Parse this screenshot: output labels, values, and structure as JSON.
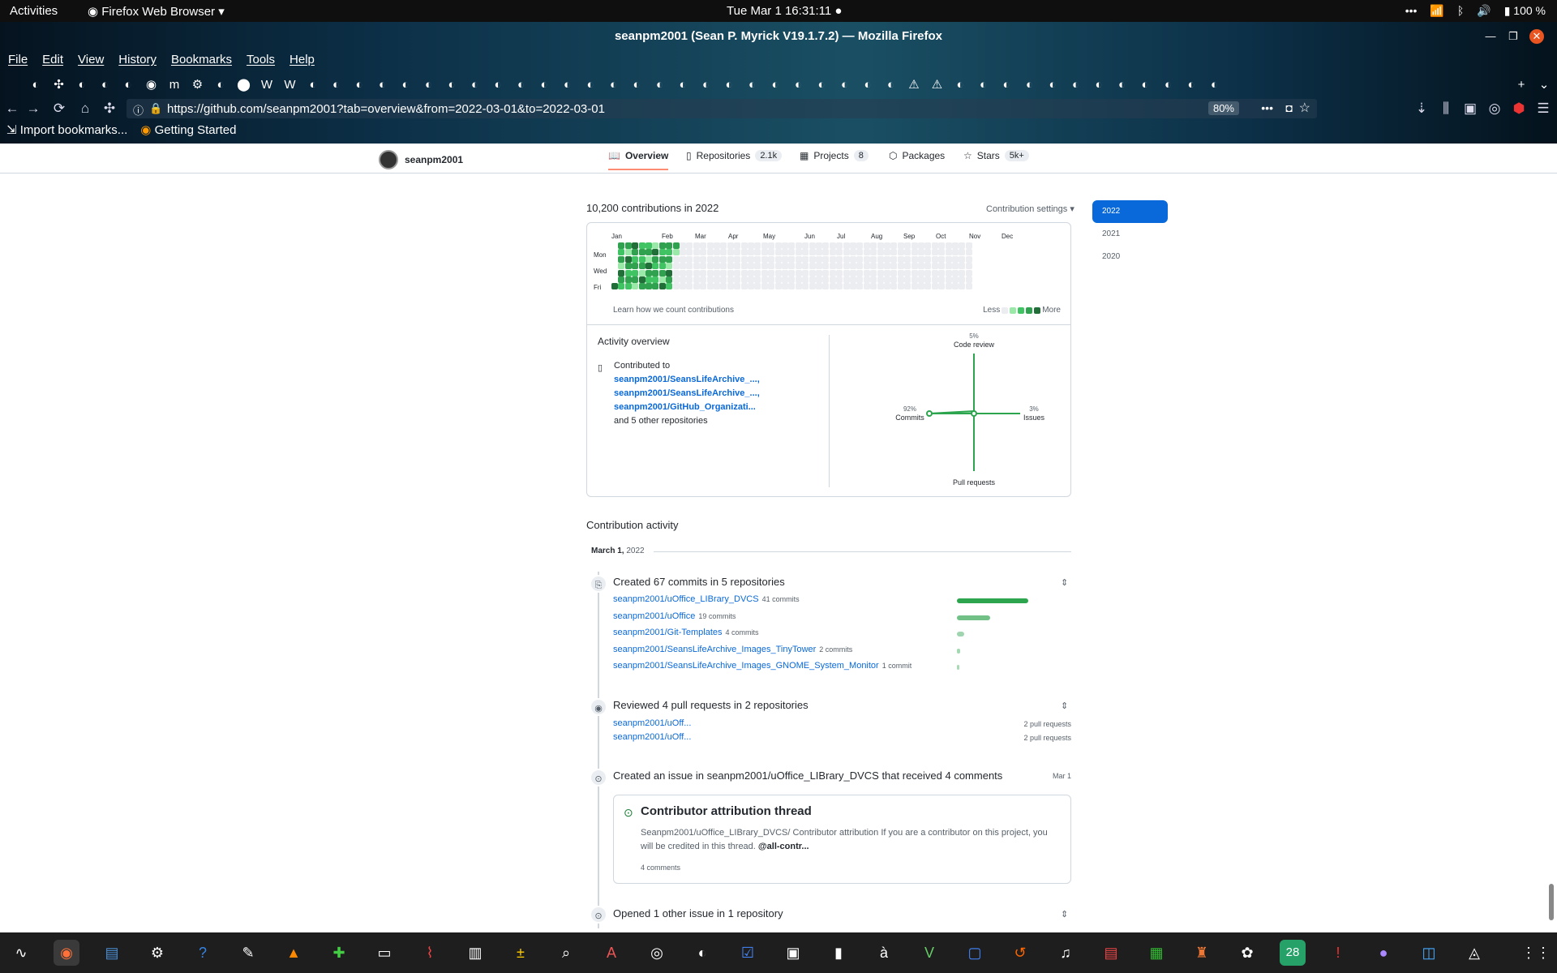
{
  "system": {
    "activities": "Activities",
    "app_menu": "Firefox Web Browser",
    "clock": "Tue Mar 1  16:31:11",
    "battery": "100 %"
  },
  "window": {
    "title": "seanpm2001 (Sean P. Myrick V19.1.7.2) — Mozilla Firefox"
  },
  "menu": [
    "File",
    "Edit",
    "View",
    "History",
    "Bookmarks",
    "Tools",
    "Help"
  ],
  "browser": {
    "url": "https://github.com/seanpm2001?tab=overview&from=2022-03-01&to=2022-03-01",
    "zoom": "80%"
  },
  "bookmarks": [
    "Import bookmarks...",
    "Getting Started"
  ],
  "github": {
    "username": "seanpm2001",
    "tabs": [
      {
        "label": "Overview",
        "count": ""
      },
      {
        "label": "Repositories",
        "count": "2.1k"
      },
      {
        "label": "Projects",
        "count": "8"
      },
      {
        "label": "Packages",
        "count": ""
      },
      {
        "label": "Stars",
        "count": "5k+"
      }
    ],
    "contributions_title": "10,200 contributions in 2022",
    "contribution_settings": "Contribution settings ▾",
    "months": [
      "Jan",
      "Feb",
      "Mar",
      "Apr",
      "May",
      "Jun",
      "Jul",
      "Aug",
      "Sep",
      "Oct",
      "Nov",
      "Dec"
    ],
    "days": [
      "Mon",
      "Wed",
      "Fri"
    ],
    "learn": "Learn how we count contributions",
    "legend_less": "Less",
    "legend_more": "More",
    "level_colors": [
      "#ebedf0",
      "#9be9a8",
      "#40c463",
      "#30a14e",
      "#216e39"
    ],
    "years": [
      "2022",
      "2021",
      "2020"
    ],
    "activity_overview": {
      "title": "Activity overview",
      "contributed_to": "Contributed to",
      "repos": [
        "seanpm2001/SeansLifeArchive_...,",
        "seanpm2001/SeansLifeArchive_...,",
        "seanpm2001/GitHub_Organizati..."
      ],
      "others": "and 5 other repositories",
      "radar": {
        "code_review": "Code review",
        "code_review_pct": "5%",
        "commits": "Commits",
        "commits_pct": "92%",
        "issues": "Issues",
        "issues_pct": "3%",
        "pull_requests": "Pull requests",
        "commits_value": 0.92,
        "code_review_value": 0.05,
        "issues_value": 0.03,
        "pull_requests_value": 0
      }
    },
    "contribution_activity": {
      "title": "Contribution activity",
      "date_month": "March 1,",
      "date_year": "2022",
      "commits_title": "Created 67 commits in 5 repositories",
      "commit_repos": [
        {
          "name": "seanpm2001/uOffice_LIBrary_DVCS",
          "count": "41 commits",
          "value": 41
        },
        {
          "name": "seanpm2001/uOffice",
          "count": "19 commits",
          "value": 19
        },
        {
          "name": "seanpm2001/Git-Templates",
          "count": "4 commits",
          "value": 4
        },
        {
          "name": "seanpm2001/SeansLifeArchive_Images_TinyTower",
          "count": "2 commits",
          "value": 2
        },
        {
          "name": "seanpm2001/SeansLifeArchive_Images_GNOME_System_Monitor",
          "count": "1 commit",
          "value": 1
        }
      ],
      "reviewed_title": "Reviewed 4 pull requests in 2 repositories",
      "reviewed": [
        {
          "name": "seanpm2001/uOff...",
          "count": "2 pull requests"
        },
        {
          "name": "seanpm2001/uOff...",
          "count": "2 pull requests"
        }
      ],
      "issue_title": "Created an issue in seanpm2001/uOffice_LIBrary_DVCS that received 4 comments",
      "issue_date": "Mar 1",
      "issue_card": {
        "title": "Contributor attribution thread",
        "body": "Seanpm2001/uOffice_LIBrary_DVCS/ Contributor attribution If you are a contributor on this project, you will be credited in this thread.",
        "mention": "@all-contr...",
        "comments": "4 comments"
      },
      "opened_title": "Opened 1 other issue in 1 repository"
    }
  },
  "dock": {
    "calendar_day": "28"
  }
}
